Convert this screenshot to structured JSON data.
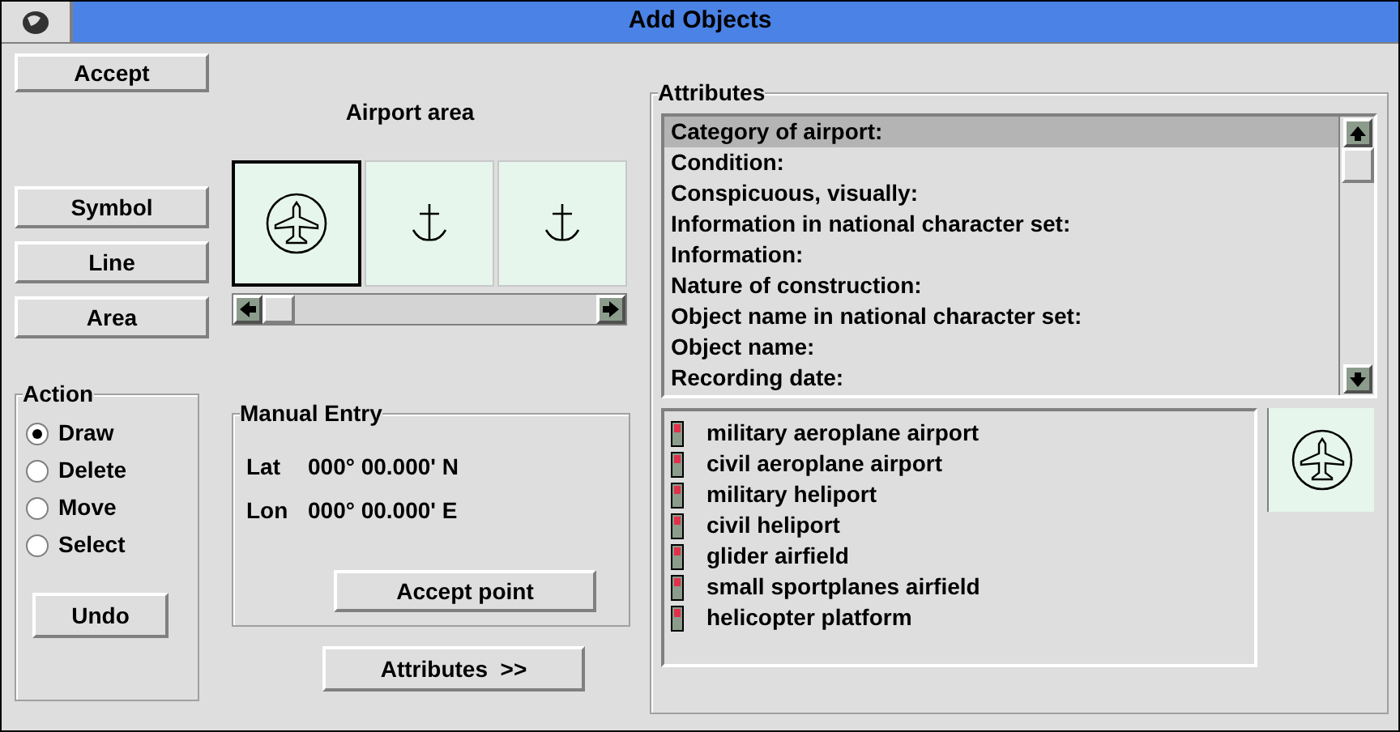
{
  "window": {
    "title": "Add Objects"
  },
  "left_buttons": {
    "accept": "Accept",
    "types": [
      {
        "label": "Symbol"
      },
      {
        "label": "Line"
      },
      {
        "label": "Area"
      }
    ]
  },
  "object_name": "Airport area",
  "symbols": [
    {
      "kind": "airport",
      "selected": true
    },
    {
      "kind": "anchor",
      "selected": false
    },
    {
      "kind": "anchor",
      "selected": false
    }
  ],
  "action": {
    "title": "Action",
    "options": [
      {
        "label": "Draw",
        "selected": true
      },
      {
        "label": "Delete",
        "selected": false
      },
      {
        "label": "Move",
        "selected": false
      },
      {
        "label": "Select",
        "selected": false
      }
    ],
    "undo": "Undo"
  },
  "manual_entry": {
    "title": "Manual Entry",
    "rows": [
      {
        "label": "Lat",
        "value": "000° 00.000' N"
      },
      {
        "label": "Lon",
        "value": "000° 00.000' E"
      }
    ],
    "button": "Accept point"
  },
  "attributes_button": "Attributes  >>",
  "attributes": {
    "title": "Attributes",
    "items": [
      {
        "label": "Category of airport:",
        "selected": true
      },
      {
        "label": "Condition:",
        "selected": false
      },
      {
        "label": "Conspicuous, visually:",
        "selected": false
      },
      {
        "label": "Information in national character set:",
        "selected": false
      },
      {
        "label": "Information:",
        "selected": false
      },
      {
        "label": "Nature of construction:",
        "selected": false
      },
      {
        "label": "Object name in national character set:",
        "selected": false
      },
      {
        "label": "Object name:",
        "selected": false
      },
      {
        "label": "Recording date:",
        "selected": false
      }
    ],
    "values": [
      "military aeroplane airport",
      "civil aeroplane airport",
      "military heliport",
      "civil heliport",
      "glider airfield",
      "small sportplanes airfield",
      "helicopter platform"
    ],
    "preview": {
      "kind": "airport"
    }
  }
}
